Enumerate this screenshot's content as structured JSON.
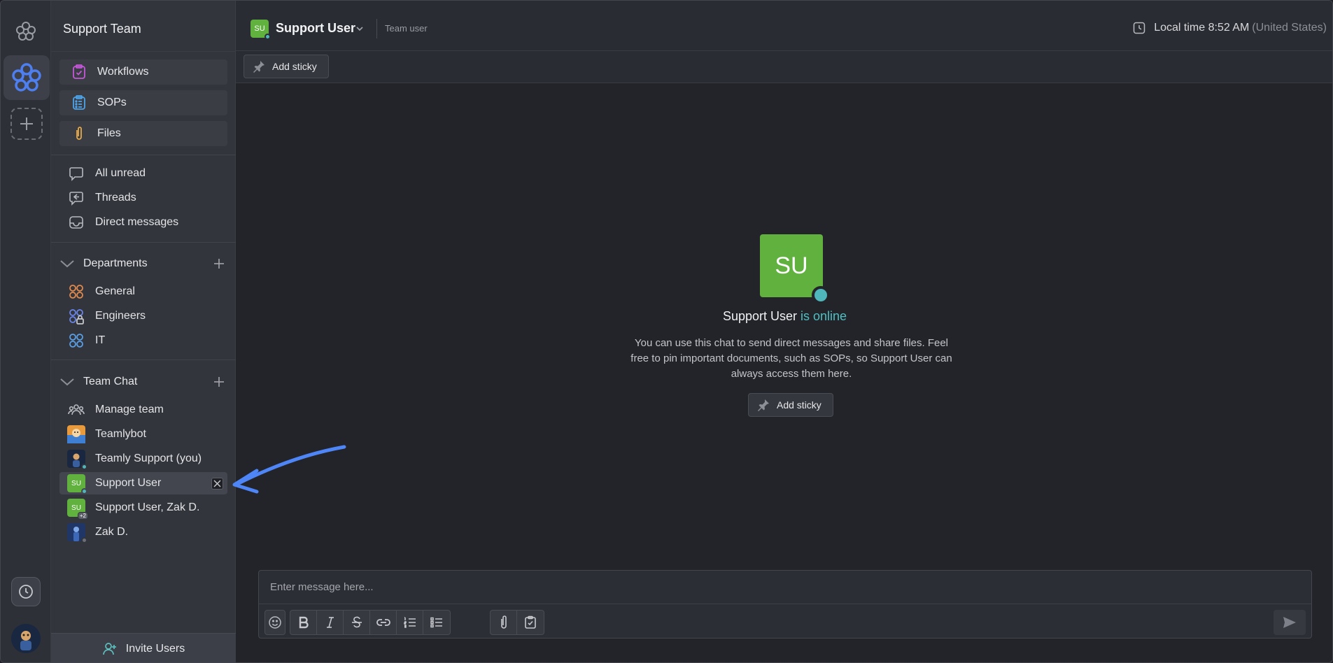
{
  "workspace": {
    "name": "Support Team"
  },
  "pinned": [
    {
      "label": "Workflows",
      "icon": "workflow-icon"
    },
    {
      "label": "SOPs",
      "icon": "sop-icon"
    },
    {
      "label": "Files",
      "icon": "paperclip-icon"
    }
  ],
  "nav": [
    {
      "label": "All unread",
      "icon": "chat-bubble-icon"
    },
    {
      "label": "Threads",
      "icon": "threads-icon"
    },
    {
      "label": "Direct messages",
      "icon": "inbox-icon"
    }
  ],
  "departments": {
    "title": "Departments",
    "items": [
      {
        "label": "General"
      },
      {
        "label": "Engineers"
      },
      {
        "label": "IT"
      }
    ]
  },
  "team_chat": {
    "title": "Team Chat",
    "items": [
      {
        "label": "Manage team"
      },
      {
        "label": "Teamlybot"
      },
      {
        "label": "Teamly Support (you)"
      },
      {
        "label": "Support User",
        "avatar": "SU",
        "selected": true
      },
      {
        "label": "Support User, Zak D.",
        "avatar": "SU",
        "badge": "+2"
      },
      {
        "label": "Zak D."
      }
    ]
  },
  "invite_label": "Invite Users",
  "header": {
    "avatar": "SU",
    "name": "Support User",
    "role": "Team user",
    "time_label": "Local time 8:52 AM",
    "time_region": "(United States)"
  },
  "sticky_label": "Add sticky",
  "empty_state": {
    "avatar": "SU",
    "name": "Support User",
    "status": "is online",
    "description": "You can use this chat to send direct messages and share files. Feel free to pin important documents, such as SOPs, so Support User can always access them here.",
    "button": "Add sticky"
  },
  "composer": {
    "placeholder": "Enter message here..."
  },
  "colors": {
    "accent_green": "#60b13d",
    "online": "#4fb6bb",
    "arrow": "#4f86f7"
  }
}
